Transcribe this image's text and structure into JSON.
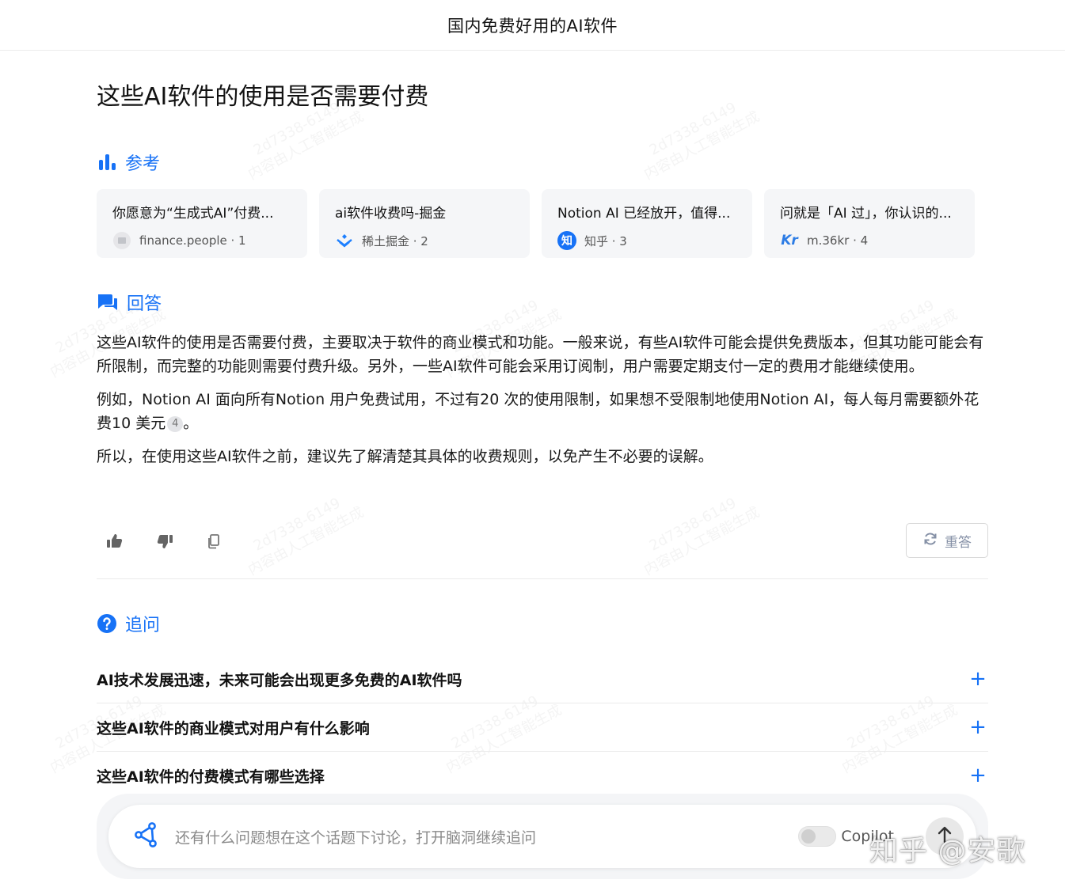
{
  "header": {
    "title": "国内免费好用的AI软件"
  },
  "question": {
    "title": "这些AI软件的使用是否需要付费"
  },
  "references": {
    "heading": "参考",
    "items": [
      {
        "title": "你愿意为“生成式AI”付费...",
        "source": "finance.people · 1",
        "icon": "newspaper-icon"
      },
      {
        "title": "ai软件收费吗-掘金",
        "source": "稀土掘金 · 2",
        "icon": "juejin-logo"
      },
      {
        "title": "Notion AI 已经放开，值得...",
        "source": "知乎 · 3",
        "icon": "zhihu-logo",
        "icon_text": "知"
      },
      {
        "title": "问就是「AI 过」，你认识的...",
        "source": "m.36kr · 4",
        "icon": "36kr-logo",
        "icon_text": "Kr"
      }
    ]
  },
  "answer": {
    "heading": "回答",
    "p1": "这些AI软件的使用是否需要付费，主要取决于软件的商业模式和功能。一般来说，有些AI软件可能会提供免费版本，但其功能可能会有所限制，而完整的功能则需要付费升级。另外，一些AI软件可能会采用订阅制，用户需要定期支付一定的费用才能继续使用。",
    "p2": "例如，Notion AI 面向所有Notion 用户免费试用，不过有20 次的使用限制，如果想不受限制地使用Notion AI，每人每月需要额外花费10 美元",
    "p2_cite": "4",
    "p2_end": "。",
    "p3": "所以，在使用这些AI软件之前，建议先了解清楚其具体的收费规则，以免产生不必要的误解。"
  },
  "actions": {
    "regenerate_label": "重答"
  },
  "followups": {
    "heading": "追问",
    "items": [
      {
        "text": "AI技术发展迅速，未来可能会出现更多免费的AI软件吗"
      },
      {
        "text": "这些AI软件的商业模式对用户有什么影响"
      },
      {
        "text": "这些AI软件的付费模式有哪些选择"
      }
    ]
  },
  "input": {
    "placeholder": "还有什么问题想在这个话题下讨论，打开脑洞继续追问",
    "toggle_label": "Copilot"
  },
  "watermark": {
    "code": "2d7338-6149",
    "text": "内容由人工智能生成",
    "corner": "知乎 @安歌"
  },
  "colors": {
    "accent": "#1772f6",
    "text": "#121212",
    "card_bg": "#f5f6f8"
  }
}
